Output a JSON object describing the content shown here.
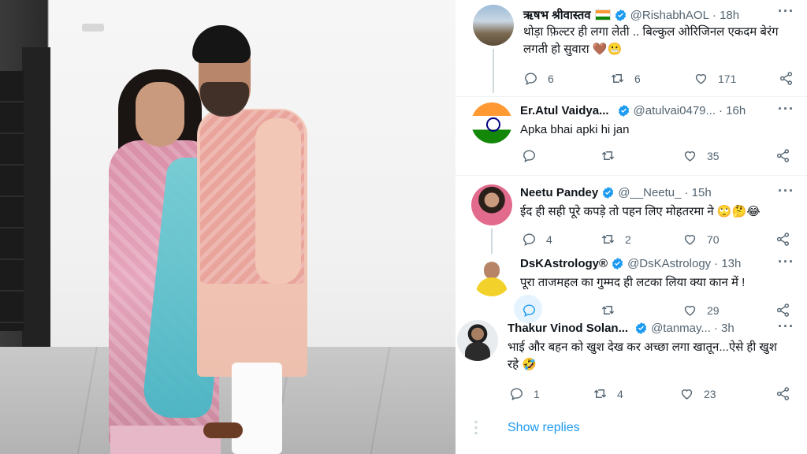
{
  "photo": {
    "alt_icon": "photo-of-couple"
  },
  "colors": {
    "accent": "#1d9bf0",
    "text": "#0f1419",
    "muted": "#536471",
    "verified": "#1d9bf0"
  },
  "tweets": [
    {
      "name": "ऋषभ श्रीवास्तव",
      "handle": "@RishabhAOL",
      "time": "· 18h",
      "text": "थोड़ा फ़िल्टर ही लगा लेती .. बिल्कुल ओरिजिनल एकदम बेरंग लगती हो सुवारा 🤎😬",
      "replies": "6",
      "retweets": "6",
      "likes": "171"
    },
    {
      "name": "Er.Atul Vaidya...",
      "handle": "@atulvai0479...",
      "time": "· 16h",
      "text": "Apka bhai apki hi jan",
      "replies": "",
      "retweets": "",
      "likes": "35"
    },
    {
      "name": "Neetu Pandey",
      "handle": "@__Neetu_",
      "time": "· 15h",
      "text": "ईद ही सही पूरे कपड़े तो पहन लिए मोहतरमा ने 🙄🤔😂",
      "replies": "4",
      "retweets": "2",
      "likes": "70"
    },
    {
      "name": "DsKAstrology®",
      "handle": "@DsKAstrology",
      "time": "· 13h",
      "text": "पूरा ताजमहल का गुम्मद ही लटका लिया क्या कान में !",
      "replies": "",
      "retweets": "",
      "likes": "29"
    },
    {
      "name": "Thakur Vinod Solan...",
      "handle": "@tanmay...",
      "time": "· 3h",
      "text": "भाई और बहन को खुश देख कर अच्छा लगा खातून...ऐसे ही खुश रहे 🤣",
      "replies": "1",
      "retweets": "4",
      "likes": "23"
    }
  ],
  "show_replies": "Show replies",
  "icons": {
    "more": "more-icon",
    "reply": "reply-icon",
    "retweet": "retweet-icon",
    "like": "like-icon",
    "share": "share-icon",
    "verified": "verified-badge-icon"
  }
}
